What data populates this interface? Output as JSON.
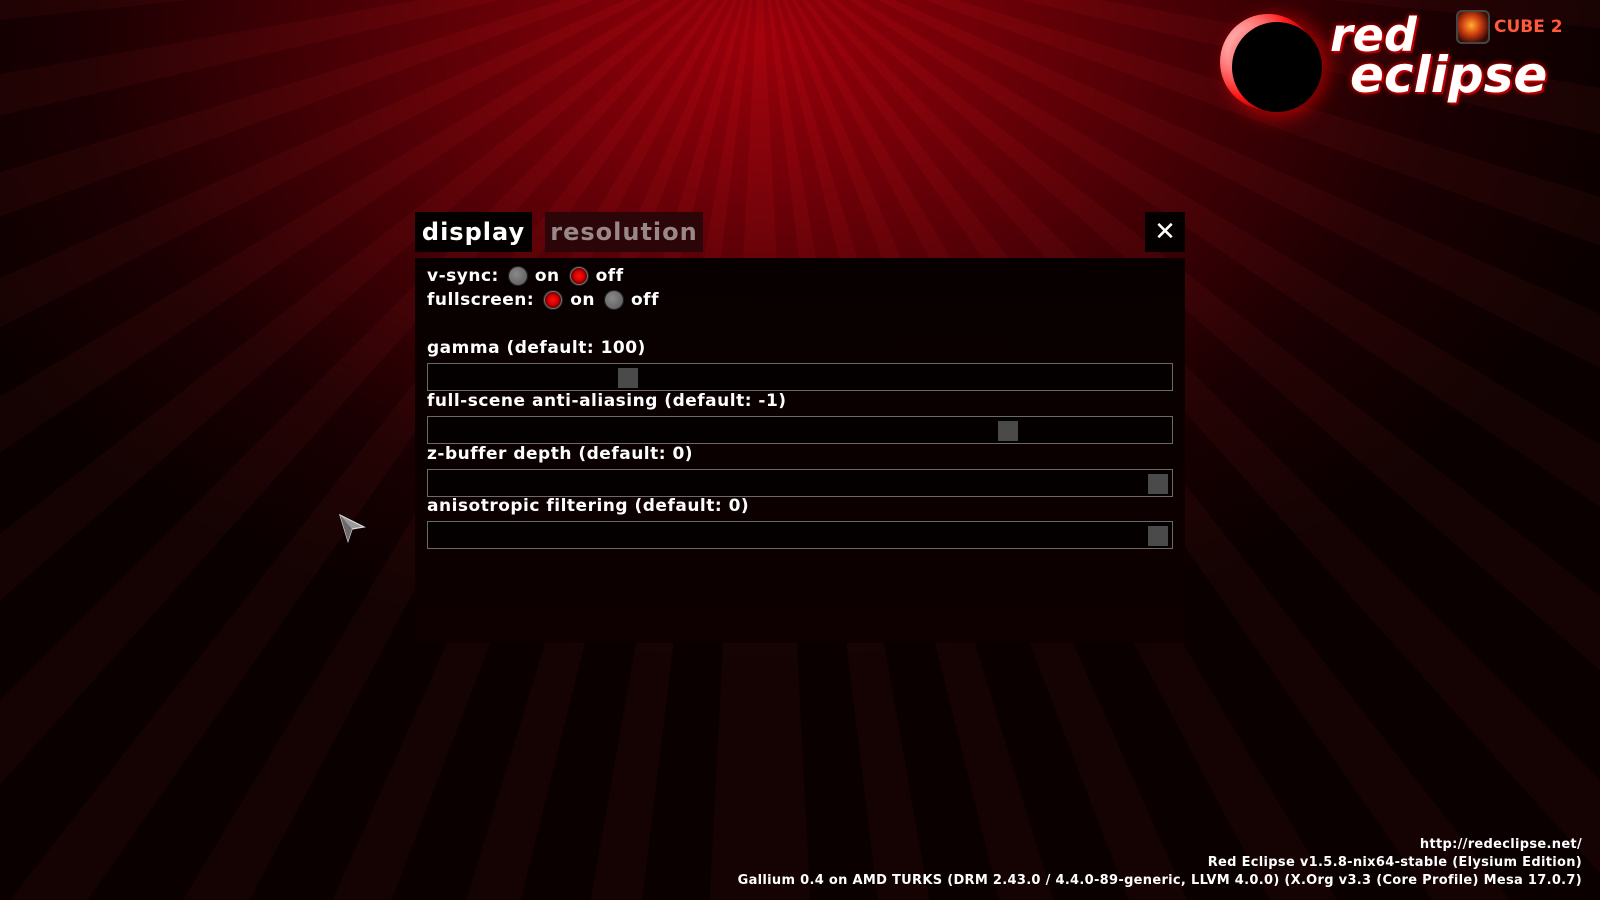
{
  "logo": {
    "word1": "red",
    "word2": "eclipse",
    "badge": "CUBE 2"
  },
  "tabs": [
    {
      "label": "display",
      "active": true
    },
    {
      "label": "resolution",
      "active": false
    }
  ],
  "close_icon": "close-icon",
  "vsync": {
    "label": "v-sync:",
    "on_label": "on",
    "off_label": "off",
    "selected": "off"
  },
  "fullscreen": {
    "label": "fullscreen:",
    "on_label": "on",
    "off_label": "off",
    "selected": "on"
  },
  "sliders": [
    {
      "label": "gamma (default: 100)",
      "position": 0.26
    },
    {
      "label": "full-scene anti-aliasing (default: -1)",
      "position": 0.79
    },
    {
      "label": "z-buffer depth (default: 0)",
      "position": 1.0
    },
    {
      "label": "anisotropic filtering (default: 0)",
      "position": 1.0
    }
  ],
  "footer": {
    "url": "http://redeclipse.net/",
    "version": "Red Eclipse v1.5.8-nix64-stable (Elysium Edition)",
    "renderer": "Gallium 0.4 on AMD TURKS (DRM 2.43.0 / 4.4.0-89-generic, LLVM 4.0.0) (X.Org v3.3 (Core Profile) Mesa 17.0.7)"
  },
  "colors": {
    "accent": "#d00000",
    "background": "#7a0008"
  }
}
